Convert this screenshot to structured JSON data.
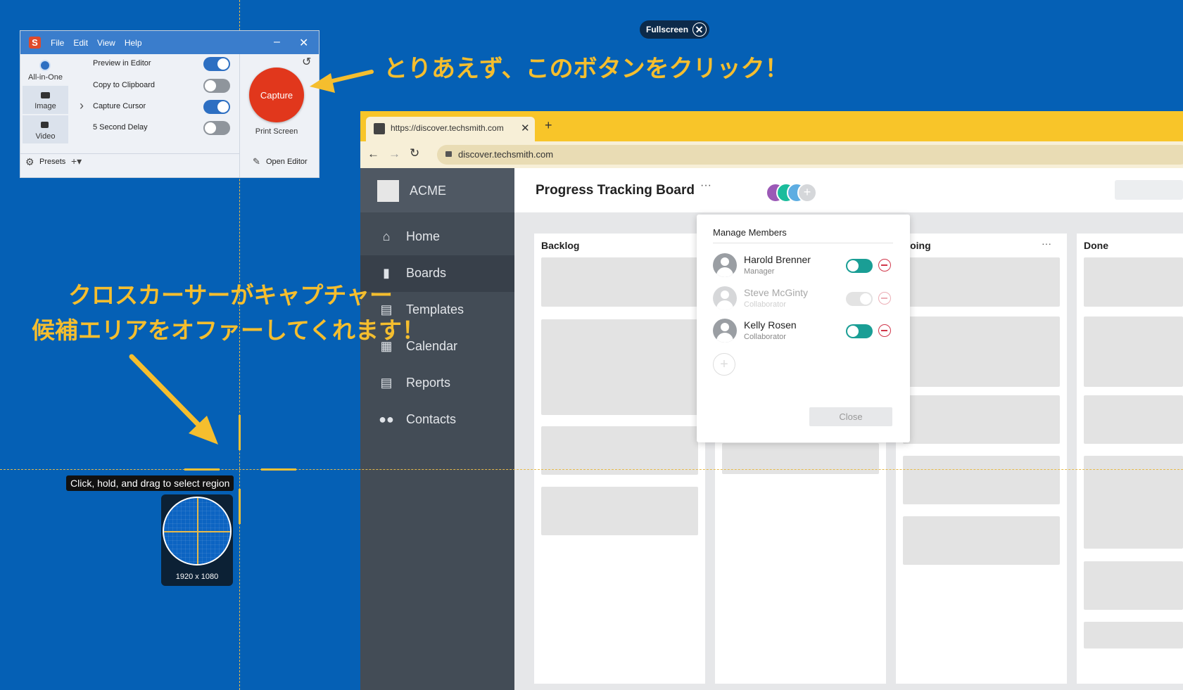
{
  "overlay": {
    "fullscreen_label": "Fullscreen",
    "annotation_top": "とりあえず、このボタンをクリック！",
    "annotation_mid_line1": "クロスカーサーがキャプチャー",
    "annotation_mid_line2": "候補エリアをオファーしてくれます！",
    "tooltip": "Click, hold, and drag to select region",
    "magnifier_size": "1920 x 1080",
    "accent_color": "#f5be2e"
  },
  "snagit": {
    "menu": [
      "File",
      "Edit",
      "View",
      "Help"
    ],
    "modes": [
      "All-in-One",
      "Image",
      "Video"
    ],
    "options": [
      {
        "label": "Preview in Editor",
        "on": true
      },
      {
        "label": "Copy to Clipboard",
        "on": false
      },
      {
        "label": "Capture Cursor",
        "on": true
      },
      {
        "label": "5 Second Delay",
        "on": false
      }
    ],
    "capture_label": "Capture",
    "print_screen_label": "Print Screen",
    "presets_label": "Presets",
    "open_editor_label": "Open Editor",
    "capture_color": "#e1371c"
  },
  "browser": {
    "tab_title": "https://discover.techsmith.com",
    "url": "discover.techsmith.com",
    "brand": "ACME",
    "nav": [
      "Home",
      "Boards",
      "Templates",
      "Calendar",
      "Reports",
      "Contacts"
    ],
    "active_nav": "Boards",
    "board_title": "Progress Tracking Board",
    "columns": [
      "Backlog",
      "Doing",
      "Done"
    ],
    "popup": {
      "title": "Manage Members",
      "members": [
        {
          "name": "Harold Brenner",
          "role": "Manager",
          "enabled": true
        },
        {
          "name": "Steve McGinty",
          "role": "Collaborator",
          "enabled": false
        },
        {
          "name": "Kelly Rosen",
          "role": "Collaborator",
          "enabled": true
        }
      ],
      "close_label": "Close"
    },
    "tabbar_color": "#f8c529",
    "sidebar_color": "#434c56"
  }
}
